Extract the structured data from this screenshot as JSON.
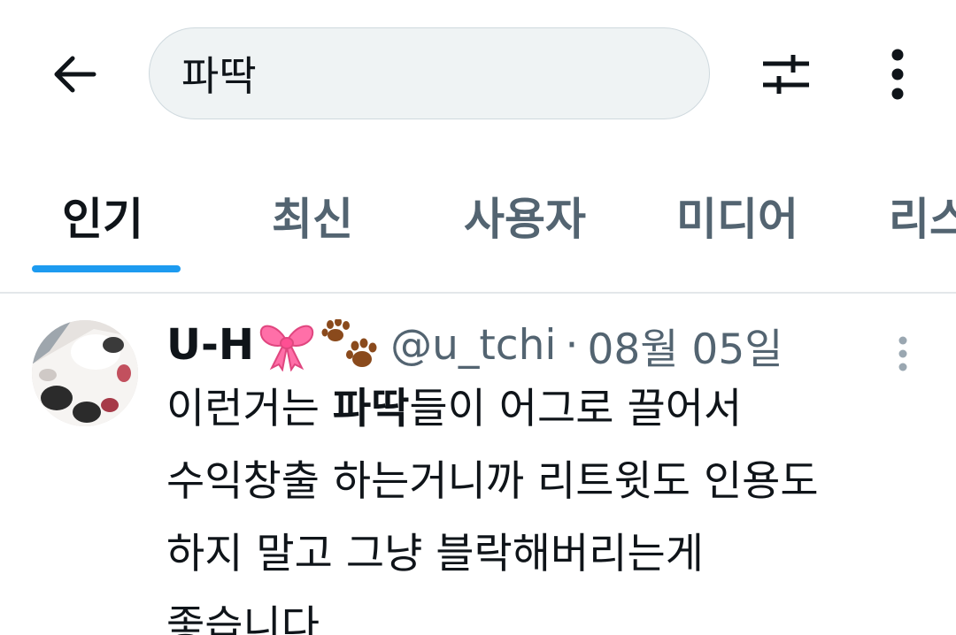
{
  "search": {
    "query": "파딱"
  },
  "icons": {
    "back": "arrow-left-icon",
    "filter": "sliders-icon",
    "more": "more-vertical-icon",
    "ribbon": "ribbon-emoji",
    "paws": "paw-prints-emoji"
  },
  "tabs": [
    {
      "label": "인기",
      "active": true
    },
    {
      "label": "최신"
    },
    {
      "label": "사용자"
    },
    {
      "label": "미디어"
    },
    {
      "label": "리스트"
    }
  ],
  "post": {
    "display_name": "U-H",
    "handle": "@u_tchi",
    "separator": "·",
    "date": "08월 05일",
    "lines": [
      {
        "before": "이런거는 ",
        "highlight": "파딱",
        "after": "들이 어그로 끌어서"
      },
      {
        "text": "수익창출 하는거니까 리트윗도 인용도"
      },
      {
        "text": "하지 말고 그냥 블락해버리는게"
      },
      {
        "text": "좋습니다"
      }
    ]
  },
  "colors": {
    "accent": "#1d9bf0",
    "primary_text": "#0f1419",
    "secondary_text": "#536471",
    "search_bg": "#eff3f4"
  }
}
